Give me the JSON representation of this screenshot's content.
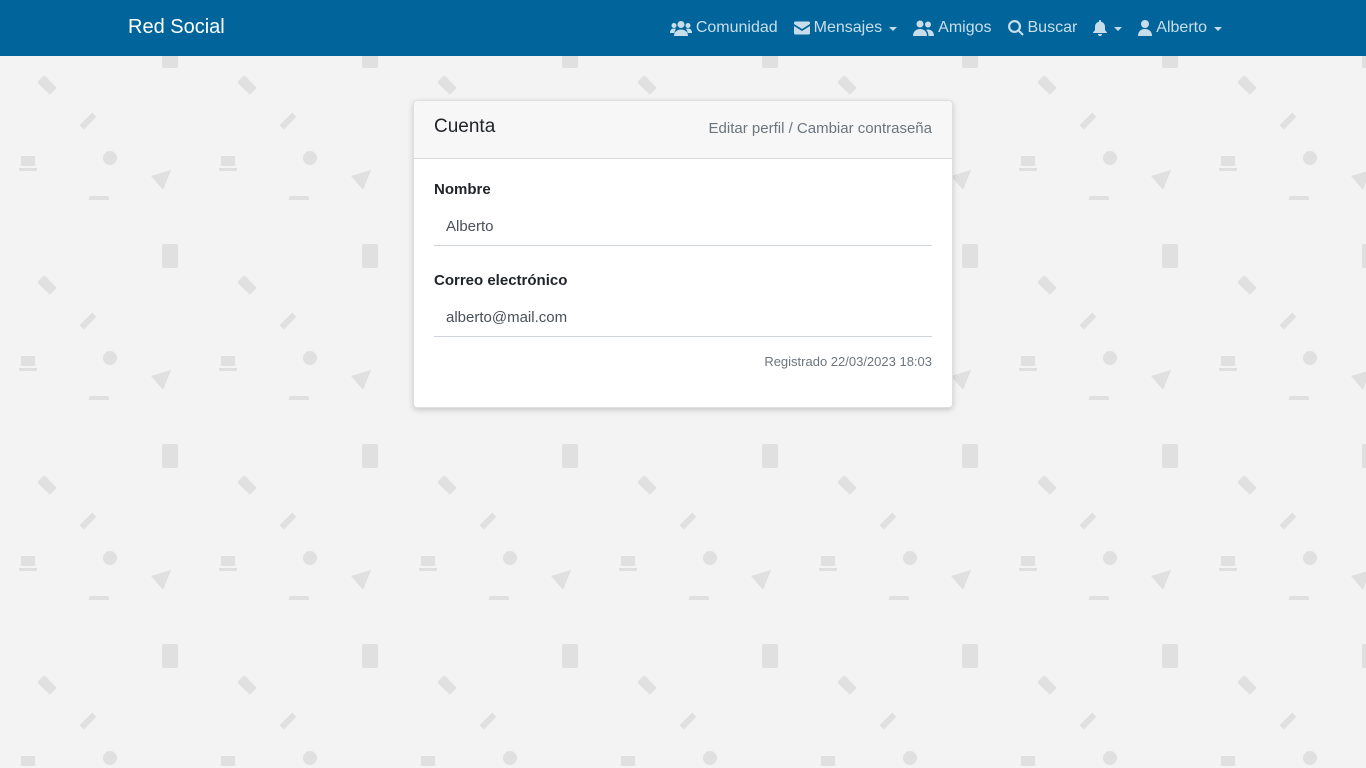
{
  "navbar": {
    "brand": "Red Social",
    "items": [
      {
        "label": "Comunidad",
        "icon": "users-icon",
        "dropdown": false
      },
      {
        "label": "Mensajes",
        "icon": "envelope-icon",
        "dropdown": true
      },
      {
        "label": "Amigos",
        "icon": "user-friends-icon",
        "dropdown": false
      },
      {
        "label": "Buscar",
        "icon": "search-icon",
        "dropdown": false
      },
      {
        "label": "",
        "icon": "bell-icon",
        "dropdown": true
      },
      {
        "label": "Alberto",
        "icon": "user-icon",
        "dropdown": true
      }
    ]
  },
  "card": {
    "title": "Cuenta",
    "links": {
      "edit_profile": "Editar perfil",
      "separator": " / ",
      "change_password": "Cambiar contraseña"
    },
    "fields": {
      "name_label": "Nombre",
      "name_value": "Alberto",
      "email_label": "Correo electrónico",
      "email_value": "alberto@mail.com"
    },
    "registered": "Registrado 22/03/2023 18:03"
  },
  "colors": {
    "navbar": "#01659b",
    "background": "#f3f3f3",
    "pattern_icon": "#e0e0e0"
  }
}
